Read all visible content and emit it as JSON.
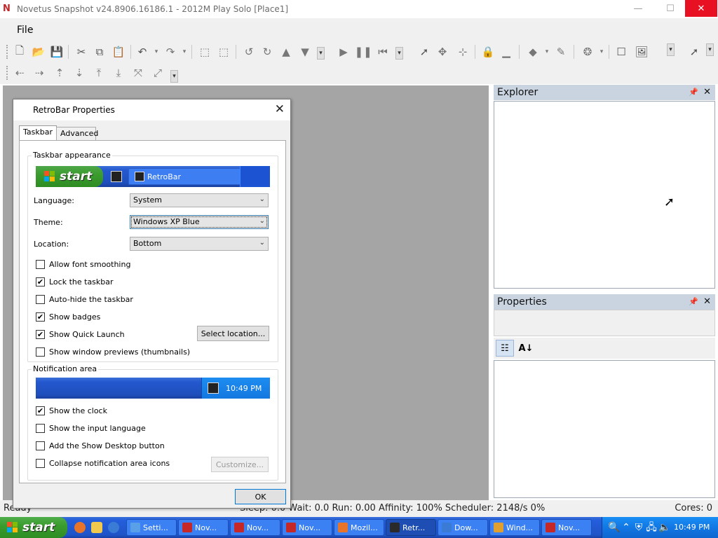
{
  "window": {
    "logo": "N",
    "title": "Novetus Snapshot v24.8906.16186.1 - 2012M Play Solo [Place1]",
    "minimize": "—",
    "maximize": "☐",
    "close": "✕"
  },
  "menu": {
    "file": "File"
  },
  "panels": {
    "explorer": {
      "title": "Explorer",
      "pin": "📌",
      "close": "✕"
    },
    "properties": {
      "title": "Properties",
      "pin": "📌",
      "close": "✕",
      "categorized_icon": "☷",
      "alphabetical_icon": "A↓"
    }
  },
  "statusbar": {
    "left": "Ready",
    "middle": "Sleep: 0.0 Wait: 0.0 Run: 0.00 Affinity: 100% Scheduler: 2148/s 0%",
    "right": "Cores: 0"
  },
  "dialog": {
    "title": "RetroBar Properties",
    "close": "✕",
    "tabs": {
      "taskbar": "Taskbar",
      "advanced": "Advanced"
    },
    "appearance": {
      "group_label": "Taskbar appearance",
      "preview_start": "start",
      "preview_task": "RetroBar",
      "language_label": "Language:",
      "language_value": "System",
      "theme_label": "Theme:",
      "theme_value": "Windows XP Blue",
      "location_label": "Location:",
      "location_value": "Bottom",
      "checkboxes": [
        {
          "label": "Allow font smoothing",
          "checked": false
        },
        {
          "label": "Lock the taskbar",
          "checked": true
        },
        {
          "label": "Auto-hide the taskbar",
          "checked": false
        },
        {
          "label": "Show badges",
          "checked": true
        },
        {
          "label": "Show Quick Launch",
          "checked": true
        },
        {
          "label": "Show window previews (thumbnails)",
          "checked": false
        }
      ],
      "select_location": "Select location..."
    },
    "notification": {
      "group_label": "Notification area",
      "preview_clock": "10:49 PM",
      "checkboxes": [
        {
          "label": "Show the clock",
          "checked": true
        },
        {
          "label": "Show the input language",
          "checked": false
        },
        {
          "label": "Add the Show Desktop button",
          "checked": false
        },
        {
          "label": "Collapse notification area icons",
          "checked": false
        }
      ],
      "customize": "Customize..."
    },
    "ok": "OK",
    "check_mark": "✔"
  },
  "taskbar": {
    "start": "start",
    "items": [
      {
        "label": "Setti...",
        "color": "#5aa0e8",
        "active": false
      },
      {
        "label": "Nov...",
        "color": "#c62828",
        "active": false
      },
      {
        "label": "Nov...",
        "color": "#c62828",
        "active": false
      },
      {
        "label": "Nov...",
        "color": "#c62828",
        "active": false
      },
      {
        "label": "Mozil...",
        "color": "#e8742a",
        "active": false
      },
      {
        "label": "Retr...",
        "color": "#2a2a2a",
        "active": true
      },
      {
        "label": "Dow...",
        "color": "#3a7bd5",
        "active": false
      },
      {
        "label": "Wind...",
        "color": "#e0a030",
        "active": false
      },
      {
        "label": "Nov...",
        "color": "#c62828",
        "active": false
      }
    ],
    "clock": "10:49 PM"
  },
  "colors": {
    "xp_blue": "#245edb",
    "start_green": "#3b9c2e",
    "close_red": "#e81123"
  }
}
